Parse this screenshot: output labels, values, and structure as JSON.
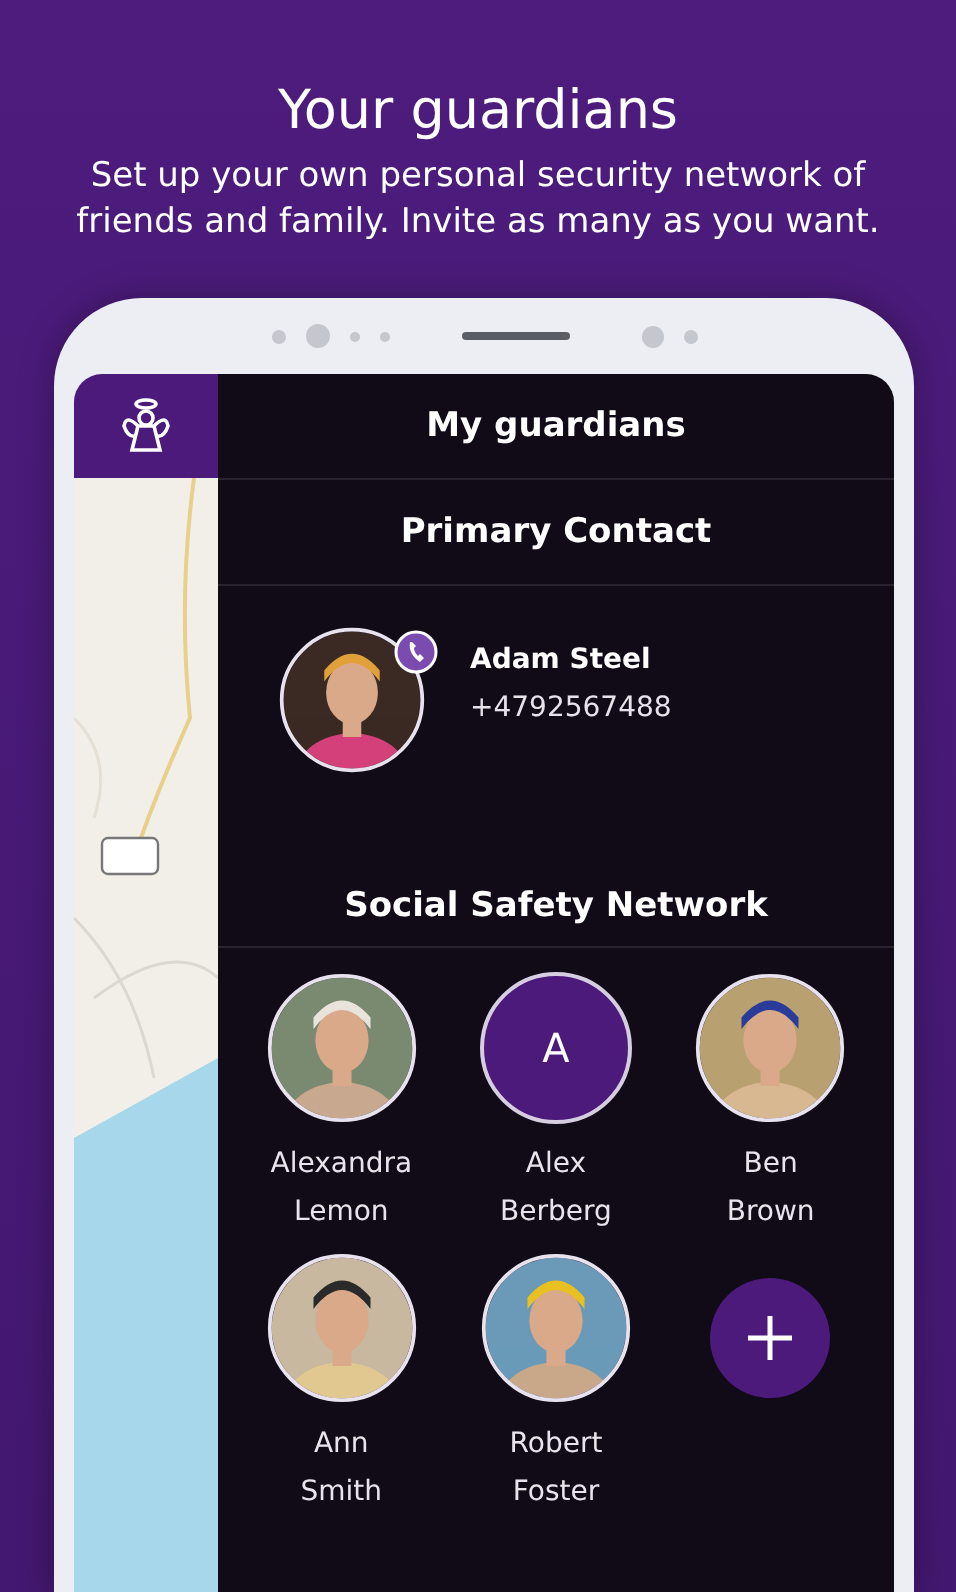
{
  "header": {
    "title": "Your guardians",
    "subtitle": "Set up your own personal security network of friends and family. Invite as many as you want."
  },
  "screen": {
    "title": "My guardians",
    "primary": {
      "heading": "Primary Contact",
      "name": "Adam Steel",
      "phone": "+4792567488"
    },
    "network": {
      "heading": "Social Safety Network",
      "members": [
        {
          "name_lines": [
            "Alexandra",
            "Lemon"
          ]
        },
        {
          "kind": "initial",
          "initial": "A",
          "name_lines": [
            "Alex",
            "Berberg"
          ]
        },
        {
          "name_lines": [
            "Ben",
            "Brown"
          ]
        },
        {
          "name_lines": [
            "Ann",
            "Smith"
          ]
        },
        {
          "name_lines": [
            "Robert",
            "Foster"
          ]
        },
        {
          "kind": "add"
        }
      ]
    }
  }
}
